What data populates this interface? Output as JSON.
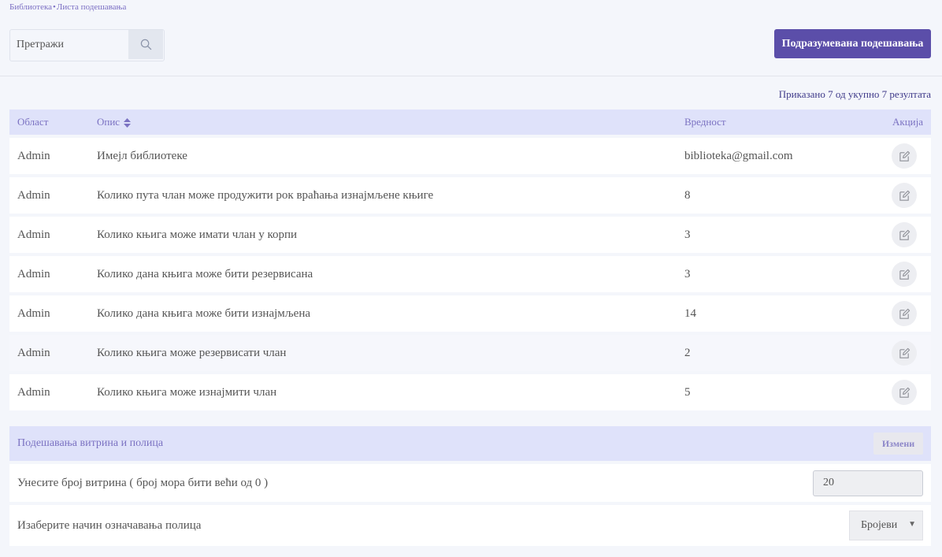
{
  "breadcrumb": {
    "home": "Библиотека",
    "separator": "•",
    "current": "Листа подешавања"
  },
  "search": {
    "placeholder": "Претражи",
    "value": ""
  },
  "toolbar": {
    "default_settings_label": "Подразумевана подешавања"
  },
  "results": {
    "text": "Приказано 7 од укупно 7 резултата"
  },
  "table": {
    "headers": {
      "area": "Област",
      "description": "Опис",
      "value": "Вредност",
      "action": "Акција"
    },
    "rows": [
      {
        "area": "Admin",
        "description": "Имејл библиотеке",
        "value": "biblioteka@gmail.com"
      },
      {
        "area": "Admin",
        "description": "Колико пута члан може продужити рок враћања изнајмљене књиге",
        "value": "8"
      },
      {
        "area": "Admin",
        "description": "Колико књига може имати члан у корпи",
        "value": "3"
      },
      {
        "area": "Admin",
        "description": "Колико дана књига може бити резервисана",
        "value": "3"
      },
      {
        "area": "Admin",
        "description": "Колико дана књига може бити изнајмљена",
        "value": "14"
      },
      {
        "area": "Admin",
        "description": "Колико књига може резервисати члан",
        "value": "2"
      },
      {
        "area": "Admin",
        "description": "Колико књига може изнајмити члан",
        "value": "5"
      }
    ]
  },
  "shelves": {
    "title": "Подешавања витрина и полица",
    "change_label": "Измени",
    "showcase_label": "Унесите број витрина ( број мора бити већи од 0 )",
    "showcase_value": "20",
    "marking_label": "Изаберите начин означавања полица",
    "marking_selected": "Бројеви"
  },
  "colors": {
    "accent": "#5b4ea9",
    "header_bg": "#dfe2fa",
    "header_text": "#7b72c2"
  }
}
